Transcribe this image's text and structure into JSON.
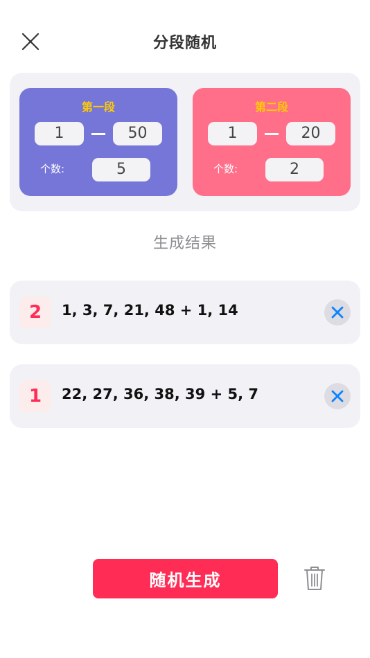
{
  "header": {
    "title": "分段随机"
  },
  "segments": [
    {
      "title": "第一段",
      "min": "1",
      "max": "50",
      "count_label": "个数:",
      "count": "5",
      "bg_color": "#7676d9",
      "title_color": "#ffcc00"
    },
    {
      "title": "第二段",
      "min": "1",
      "max": "20",
      "count_label": "个数:",
      "count": "2",
      "bg_color": "#ff6f8a",
      "title_color": "#ffcc00"
    }
  ],
  "results": {
    "title": "生成结果",
    "items": [
      {
        "index": "2",
        "text": "1, 3, 7, 21, 48 + 1, 14"
      },
      {
        "index": "1",
        "text": "22, 27, 36, 38, 39 + 5, 7"
      }
    ]
  },
  "actions": {
    "generate_label": "随机生成"
  },
  "icons": {
    "close": "close-icon",
    "delete": "x-icon",
    "trash": "trash-icon"
  },
  "colors": {
    "accent": "#ff2d55",
    "delete_blue": "#0a84ff"
  }
}
